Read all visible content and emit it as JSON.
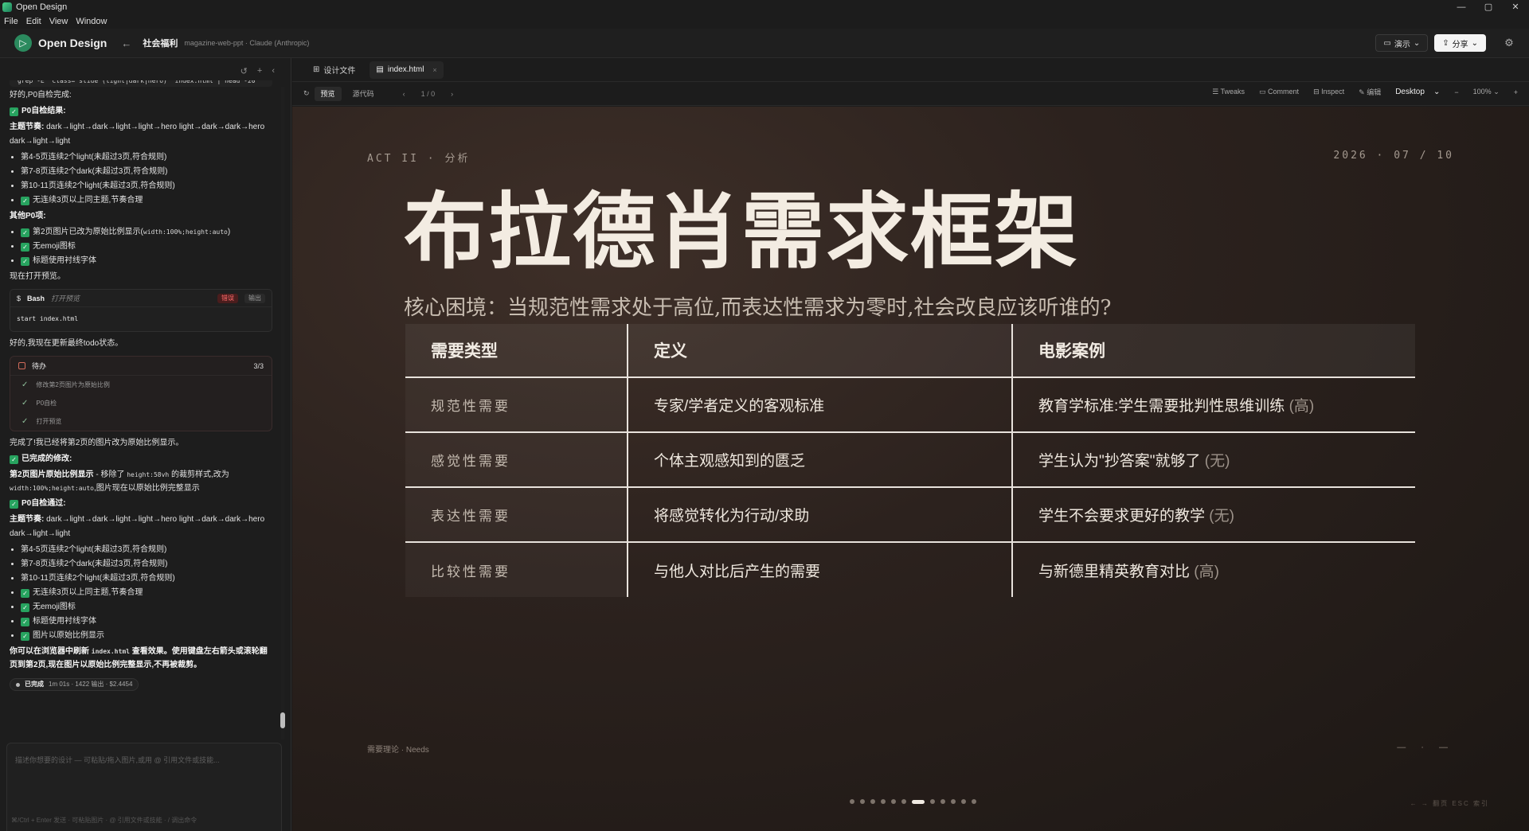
{
  "window": {
    "title": "Open Design",
    "controls": [
      "—",
      "▢",
      "✕"
    ]
  },
  "menu": [
    "File",
    "Edit",
    "View",
    "Window"
  ],
  "header": {
    "brand": "Open Design",
    "project": "社会福利",
    "project_meta": "magazine-web-ppt · Claude (Anthropic)",
    "present_label": "演示",
    "share_label": "分享"
  },
  "chat": {
    "top_code": "grep -E 'class=\"slide (light|dark|hero)' index.html | head -20",
    "msg1": "好的,P0自检完成:",
    "h1": "P0自检结果:",
    "rhythm_label": "主题节奏:",
    "rhythm_text": "dark→light→dark→light→light→hero light→dark→dark→hero dark→light→light",
    "list1": [
      "第4-5页连续2个light(未超过3页,符合规则)",
      "第7-8页连续2个dark(未超过3页,符合规则)",
      "第10-11页连续2个light(未超过3页,符合规则)",
      "无连续3页以上同主题,节奏合理"
    ],
    "h2": "其他P0项:",
    "list2_a_pre": "第2页图片已改为原始比例显示(",
    "list2_a_code": "width:100%;height:auto",
    "list2_a_post": ")",
    "list2_rest": [
      "无emoji图标",
      "标题使用衬线字体"
    ],
    "msg2": "现在打开预览。",
    "bash": {
      "name": "Bash",
      "desc": "打开预览",
      "err": "错误",
      "out": "输出",
      "cmd": "start index.html"
    },
    "msg3": "好的,我现在更新最终todo状态。",
    "todo": {
      "title": "待办",
      "count": "3/3",
      "items": [
        "修改第2页图片为原始比例",
        "P0自检",
        "打开预览"
      ]
    },
    "msg4": "完成了!我已经将第2页的图片改为原始比例显示。",
    "h3": "已完成的修改:",
    "mod_label": "第2页图片原始比例显示",
    "mod_pre": " - 移除了 ",
    "mod_code1": "height:58vh",
    "mod_mid": " 的裁剪样式,改为 ",
    "mod_code2": "width:100%;height:auto",
    "mod_post": ",图片现在以原始比例完整显示",
    "h4": "P0自检通过:",
    "list3": [
      "第4-5页连续2个light(未超过3页,符合规则)",
      "第7-8页连续2个dark(未超过3页,符合规则)",
      "第10-11页连续2个light(未超过3页,符合规则)"
    ],
    "list4": [
      "无连续3页以上同主题,节奏合理",
      "无emoji图标",
      "标题使用衬线字体",
      "图片以原始比例显示"
    ],
    "final_pre": "你可以在浏览器中刷新 ",
    "final_code": "index.html",
    "final_post": " 查看效果。使用键盘左右箭头或滚轮翻页到第2页,现在图片以原始比例完整显示,不再被裁剪。",
    "done": {
      "label": "已完成",
      "stats": "1m 01s · 1422 输出 · $2.4454"
    }
  },
  "composer": {
    "placeholder": "描述你想要的设计 — 可粘贴/拖入图片,或用 @ 引用文件或技能...",
    "send_label": "发送",
    "hint": "⌘/Ctrl + Enter 发送 · 可粘贴图片 · @ 引用文件或技能 · / 调出命令"
  },
  "tabs": [
    {
      "label": "设计文件"
    },
    {
      "label": "index.html"
    }
  ],
  "viewbar": {
    "preview": "预览",
    "source": "源代码",
    "page": "1 / 0",
    "tweaks": "Tweaks",
    "comment": "Comment",
    "inspect": "Inspect",
    "edit": "编辑",
    "device": "Desktop",
    "zoom": "100%"
  },
  "slide": {
    "kicker": "ACT II · 分析",
    "date": "2026 · 07 / 10",
    "title": "布拉德肖需求框架",
    "subtitle": "核心困境：当规范性需求处于高位,而表达性需求为零时,社会改良应该听谁的?",
    "table": {
      "headers": [
        "需要类型",
        "定义",
        "电影案例"
      ],
      "rows": [
        {
          "type": "规范性需要",
          "def": "专家/学者定义的客观标准",
          "case": "教育学标准:学生需要批判性思维训练",
          "tag": "(高)"
        },
        {
          "type": "感觉性需要",
          "def": "个体主观感知到的匮乏",
          "case": "学生认为\"抄答案\"就够了",
          "tag": "(无)"
        },
        {
          "type": "表达性需要",
          "def": "将感觉转化为行动/求助",
          "case": "学生不会要求更好的教学",
          "tag": "(无)"
        },
        {
          "type": "比较性需要",
          "def": "与他人对比后产生的需要",
          "case": "与新德里精英教育对比",
          "tag": "(高)"
        }
      ]
    },
    "footer_left": "需要理论 · Needs",
    "footer_right": "— · —",
    "nav_hint": "← → 翻页   ESC 索引",
    "dots_total": 12,
    "dots_current": 7
  }
}
